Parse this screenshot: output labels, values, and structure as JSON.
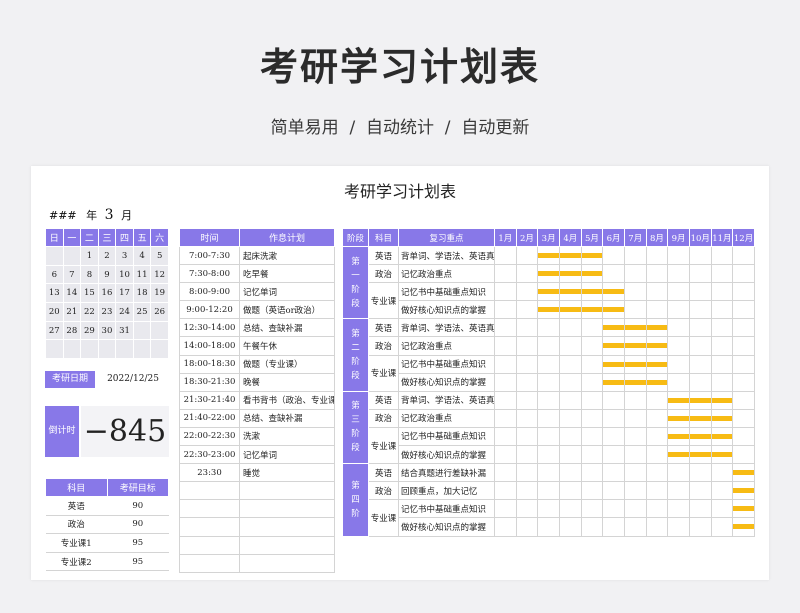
{
  "hero": {
    "title": "考研学习计划表",
    "subtitle": "简单易用  /  自动统计  /  自动更新"
  },
  "sheet": {
    "title": "考研学习计划表",
    "year": "###",
    "year_unit": "年",
    "month": "3",
    "month_unit": "月"
  },
  "calendar": {
    "headers": [
      "日",
      "一",
      "二",
      "三",
      "四",
      "五",
      "六"
    ],
    "rows": [
      [
        "",
        "",
        "1",
        "2",
        "3",
        "4",
        "5"
      ],
      [
        "6",
        "7",
        "8",
        "9",
        "10",
        "11",
        "12"
      ],
      [
        "13",
        "14",
        "15",
        "16",
        "17",
        "18",
        "19"
      ],
      [
        "20",
        "21",
        "22",
        "23",
        "24",
        "25",
        "26"
      ],
      [
        "27",
        "28",
        "29",
        "30",
        "31",
        "",
        ""
      ],
      [
        "",
        "",
        "",
        "",
        "",
        "",
        ""
      ]
    ]
  },
  "exam_date": {
    "label": "考研日期",
    "value": "2022/12/25"
  },
  "countdown": {
    "label": "倒计时",
    "value": "−845"
  },
  "goals": {
    "headers": [
      "科目",
      "考研目标"
    ],
    "rows": [
      [
        "英语",
        "90"
      ],
      [
        "政治",
        "90"
      ],
      [
        "专业课1",
        "95"
      ],
      [
        "专业课2",
        "95"
      ]
    ]
  },
  "schedule": {
    "headers": [
      "时间",
      "作息计划"
    ],
    "rows": [
      [
        "7:00-7:30",
        "起床洗漱"
      ],
      [
        "7:30-8:00",
        "吃早餐"
      ],
      [
        "8:00-9:00",
        "记忆单词"
      ],
      [
        "9:00-12:20",
        "做题（英语or政治）"
      ],
      [
        "12:30-14:00",
        "总结、查缺补漏"
      ],
      [
        "14:00-18:00",
        "午餐午休"
      ],
      [
        "18:00-18:30",
        "做题（专业课）"
      ],
      [
        "18:30-21:30",
        "晚餐"
      ],
      [
        "21:30-21:40",
        "看书背书（政治、专业课）"
      ],
      [
        "21:40-22:00",
        "总结、查缺补漏"
      ],
      [
        "22:00-22:30",
        "洗漱"
      ],
      [
        "22:30-23:00",
        "记忆单词"
      ],
      [
        "23:30",
        "睡觉"
      ],
      [
        "",
        ""
      ],
      [
        "",
        ""
      ],
      [
        "",
        ""
      ],
      [
        "",
        ""
      ],
      [
        "",
        ""
      ]
    ]
  },
  "plan": {
    "headers": [
      "阶段",
      "科目",
      "复习重点"
    ],
    "months": [
      "1月",
      "2月",
      "3月",
      "4月",
      "5月",
      "6月",
      "7月",
      "8月",
      "9月",
      "10月",
      "11月",
      "12月"
    ],
    "stages": [
      {
        "label": "第一阶段",
        "rows": [
          {
            "subject": "英语",
            "focus": "背单词、学语法、英语真题",
            "start": 3,
            "end": 5
          },
          {
            "subject": "政治",
            "focus": "记忆政治重点",
            "start": 3,
            "end": 5
          },
          {
            "subject": "专业课",
            "focus": "记忆书中基础重点知识",
            "start": 3,
            "end": 6
          },
          {
            "subject": "",
            "focus": "做好核心知识点的掌握",
            "start": 3,
            "end": 6
          }
        ]
      },
      {
        "label": "第二阶段",
        "rows": [
          {
            "subject": "英语",
            "focus": "背单词、学语法、英语真题",
            "start": 6,
            "end": 8
          },
          {
            "subject": "政治",
            "focus": "记忆政治重点",
            "start": 6,
            "end": 8
          },
          {
            "subject": "专业课",
            "focus": "记忆书中基础重点知识",
            "start": 6,
            "end": 8
          },
          {
            "subject": "",
            "focus": "做好核心知识点的掌握",
            "start": 6,
            "end": 8
          }
        ]
      },
      {
        "label": "第三阶段",
        "rows": [
          {
            "subject": "英语",
            "focus": "背单词、学语法、英语真题",
            "start": 9,
            "end": 11
          },
          {
            "subject": "政治",
            "focus": "记忆政治重点",
            "start": 9,
            "end": 11
          },
          {
            "subject": "专业课",
            "focus": "记忆书中基础重点知识",
            "start": 9,
            "end": 11
          },
          {
            "subject": "",
            "focus": "做好核心知识点的掌握",
            "start": 9,
            "end": 11
          }
        ]
      },
      {
        "label": "第四阶",
        "rows": [
          {
            "subject": "英语",
            "focus": "结合真题进行差缺补漏",
            "start": 12,
            "end": 12
          },
          {
            "subject": "政治",
            "focus": "回顾重点，加大记忆",
            "start": 12,
            "end": 12
          },
          {
            "subject": "专业课",
            "focus": "记忆书中基础重点知识",
            "start": 12,
            "end": 12
          },
          {
            "subject": "",
            "focus": "做好核心知识点的掌握",
            "start": 12,
            "end": 12
          }
        ]
      }
    ]
  },
  "colors": {
    "accent": "#8878e8",
    "bar": "#f7bb14"
  }
}
